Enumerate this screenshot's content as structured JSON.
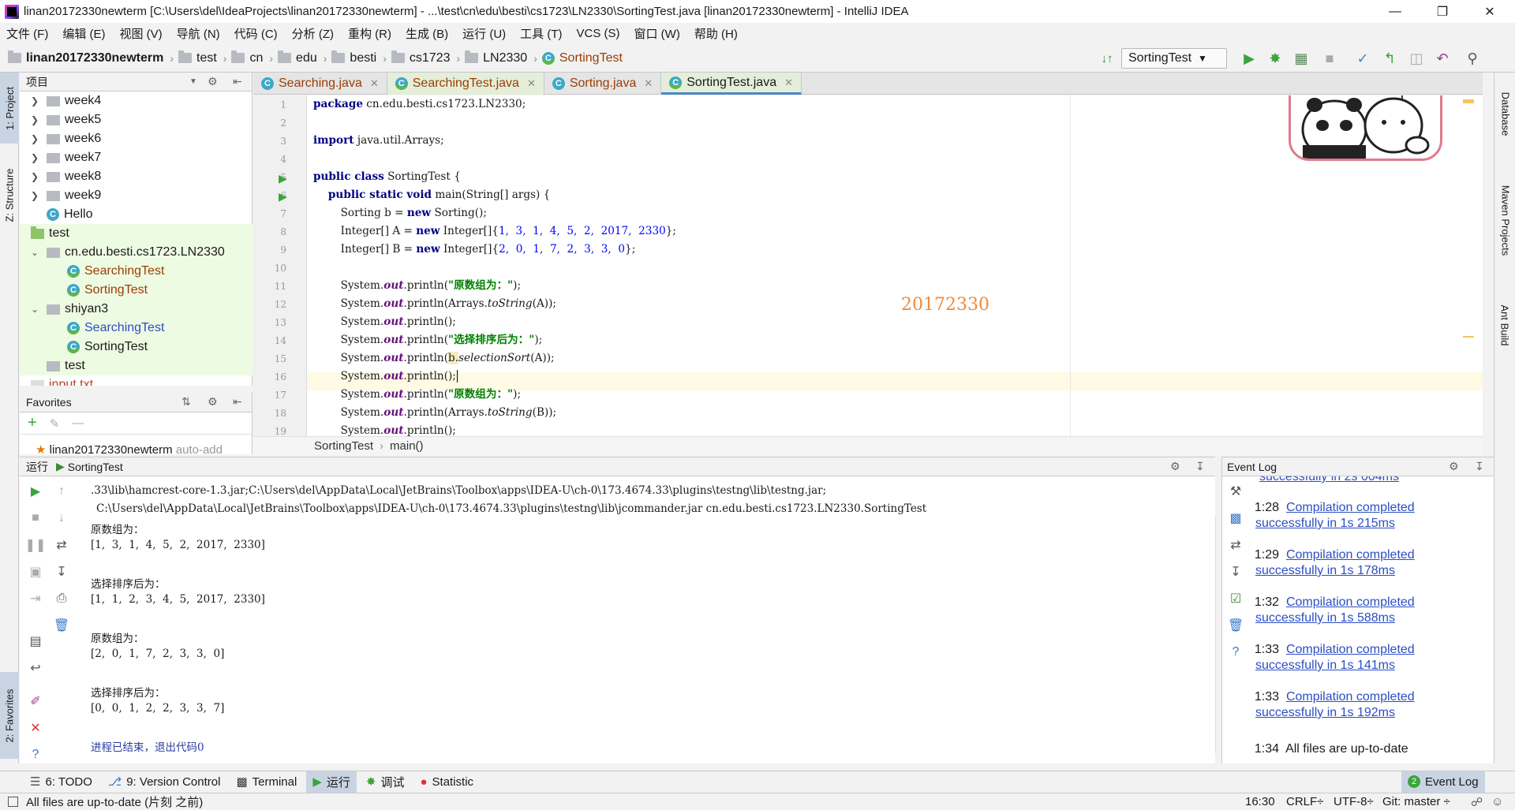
{
  "window": {
    "title": "linan20172330newterm [C:\\Users\\del\\IdeaProjects\\linan20172330newterm] - ...\\test\\cn\\edu\\besti\\cs1723\\LN2330\\SortingTest.java [linan20172330newterm] - IntelliJ IDEA"
  },
  "menu": [
    "文件 (F)",
    "编辑 (E)",
    "视图 (V)",
    "导航 (N)",
    "代码 (C)",
    "分析 (Z)",
    "重构 (R)",
    "生成 (B)",
    "运行 (U)",
    "工具 (T)",
    "VCS (S)",
    "窗口 (W)",
    "帮助 (H)"
  ],
  "nav": {
    "project": "linan20172330newterm",
    "crumbs": [
      "test",
      "cn",
      "edu",
      "besti",
      "cs1723",
      "LN2330"
    ],
    "file": "SortingTest",
    "run_config": "SortingTest"
  },
  "left_tabs": {
    "project": "1: Project",
    "structure": "Z: Structure",
    "favorites": "2: Favorites"
  },
  "right_tabs": {
    "database": "Database",
    "maven": "Maven Projects",
    "ant": "Ant Build"
  },
  "project_panel": {
    "title": "项目",
    "items": [
      {
        "label": "week4"
      },
      {
        "label": "week5"
      },
      {
        "label": "week6"
      },
      {
        "label": "week7"
      },
      {
        "label": "week8"
      },
      {
        "label": "week9"
      },
      {
        "label": "Hello"
      },
      {
        "label": "test"
      },
      {
        "label": "cn.edu.besti.cs1723.LN2330"
      },
      {
        "label": "SearchingTest"
      },
      {
        "label": "SortingTest"
      },
      {
        "label": "shiyan3"
      },
      {
        "label": "SearchingTest"
      },
      {
        "label": "SortingTest"
      },
      {
        "label": "test"
      },
      {
        "label": "input.txt"
      }
    ]
  },
  "favorites": {
    "title": "Favorites",
    "item": "linan20172330newterm",
    "item_suffix": "auto-add"
  },
  "editor_tabs": [
    {
      "label": "Searching.java"
    },
    {
      "label": "SearchingTest.java"
    },
    {
      "label": "Sorting.java"
    },
    {
      "label": "SortingTest.java"
    }
  ],
  "code": {
    "line_numbers": [
      "1",
      "2",
      "3",
      "4",
      "5",
      "6",
      "7",
      "8",
      "9",
      "10",
      "11",
      "12",
      "13",
      "14",
      "15",
      "16",
      "17",
      "18",
      "19"
    ],
    "watermark": "20172330",
    "l1a": "package",
    "l1b": " cn.edu.besti.cs1723.LN2330;",
    "l3a": "import",
    "l3b": " java.util.Arrays;",
    "l5a": "public class",
    "l5b": " SortingTest {",
    "l6a": "    public static void",
    "l6b": " main(String[] args) {",
    "l7a": "        Sorting b = ",
    "l7b": "new",
    "l7c": " Sorting();",
    "l8a": "        Integer[] A = ",
    "l8b": "new",
    "l8c": " Integer[]{",
    "l8d": "1,  3,  1,  4,  5,  2,  2017,  2330",
    "l8e": "};",
    "l9a": "        Integer[] B = ",
    "l9b": "new",
    "l9c": " Integer[]{",
    "l9d": "2,  0,  1,  7,  2,  3,  3,  0",
    "l9e": "};",
    "sys": "        System.",
    "out": "out",
    "println": ".println(",
    "s1": "\"原数组为：\"",
    "s2": "\"选择排序后为：\"",
    "arr_ts": "Arrays.",
    "tostring": "toString",
    "argA": "(A)",
    "argB": "(B)",
    "close": ");",
    "empty": "();",
    "b_sel": "b.",
    "sel": "selectionSort"
  },
  "code_breadcrumb": {
    "cls": "SortingTest",
    "method": "main()"
  },
  "run_panel": {
    "label": "运行",
    "config": "SortingTest",
    "lines": [
      ".33\\lib\\hamcrest-core-1.3.jar;C:\\Users\\del\\AppData\\Local\\JetBrains\\Toolbox\\apps\\IDEA-U\\ch-0\\173.4674.33\\plugins\\testng\\lib\\testng.jar;",
      "C:\\Users\\del\\AppData\\Local\\JetBrains\\Toolbox\\apps\\IDEA-U\\ch-0\\173.4674.33\\plugins\\testng\\lib\\jcommander.jar cn.edu.besti.cs1723.LN2330.SortingTest",
      "原数组为：",
      "[1,  3,  1,  4,  5,  2,  2017,  2330]",
      "选择排序后为：",
      "[1,  1,  2,  3,  4,  5,  2017,  2330]",
      "原数组为：",
      "[2,  0,  1,  7,  2,  3,  3,  0]",
      "选择排序后为：",
      "[0,  0,  1,  2,  2,  3,  3,  7]",
      "进程已结束，退出代码0"
    ]
  },
  "event_log": {
    "title": "Event Log",
    "partial": "successfully in 2s 004ms",
    "entries": [
      {
        "time": "21:28",
        "l1": "Compilation completed",
        "l2": "successfully in 1s 215ms"
      },
      {
        "time": "21:29",
        "l1": "Compilation completed",
        "l2": "successfully in 1s 178ms"
      },
      {
        "time": "21:32",
        "l1": "Compilation completed",
        "l2": "successfully in 1s 588ms"
      },
      {
        "time": "21:33",
        "l1": "Compilation completed",
        "l2": "successfully in 1s 141ms"
      },
      {
        "time": "21:33",
        "l1": "Compilation completed",
        "l2": "successfully in 1s 192ms"
      },
      {
        "time": "21:34",
        "l1": "All files are up-to-date",
        "l2": ""
      }
    ]
  },
  "bottom_tabs": {
    "todo": "6: TODO",
    "vcs": "9: Version Control",
    "terminal": "Terminal",
    "run": "运行",
    "debug": "调试",
    "statistic": "Statistic",
    "eventlog": "Event Log",
    "eventlog_badge": "2"
  },
  "status": {
    "message": "All files are up-to-date (片刻 之前)",
    "position": "16:30",
    "line_sep": "CRLF÷",
    "encoding": "UTF-8÷",
    "git": "Git: master ÷"
  },
  "sticker": {
    "glyph1": "A",
    "glyph2": "半"
  }
}
